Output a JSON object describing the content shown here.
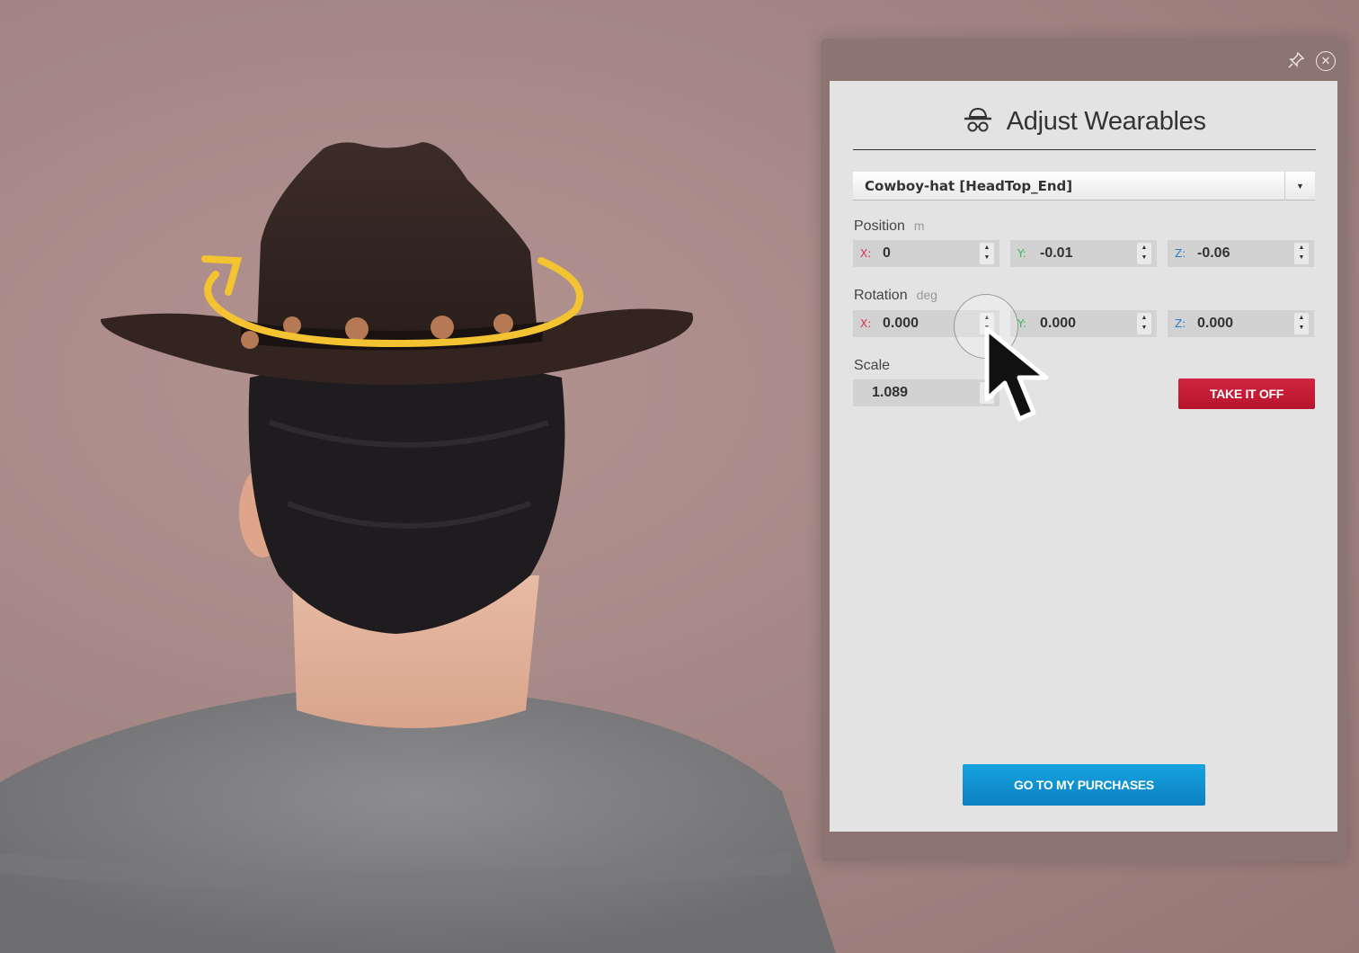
{
  "panel": {
    "title": "Adjust Wearables",
    "dropdown_value": "Cowboy-hat [HeadTop_End]",
    "position": {
      "label": "Position",
      "unit": "m",
      "x_label": "X:",
      "x": "0",
      "y_label": "Y:",
      "y": "-0.01",
      "z_label": "Z:",
      "z": "-0.06"
    },
    "rotation": {
      "label": "Rotation",
      "unit": "deg",
      "x_label": "X:",
      "x": "0.000",
      "y_label": "Y:",
      "y": "0.000",
      "z_label": "Z:",
      "z": "0.000"
    },
    "scale": {
      "label": "Scale",
      "value": "1.089"
    },
    "take_off_label": "TAKE IT OFF",
    "purchases_label": "GO TO MY PURCHASES"
  },
  "colors": {
    "axis_x": "#d9324a",
    "axis_y": "#3bb55a",
    "axis_z": "#2f7cc6",
    "take_off": "#c41d37",
    "purchases": "#1496d6",
    "rotation_gizmo": "#f3c332"
  },
  "icons": {
    "frame": [
      "pin-icon",
      "close-icon"
    ],
    "title": "hat-glasses-icon",
    "dropdown": "caret-down-icon",
    "scene": "rotation-arrow-icon"
  }
}
